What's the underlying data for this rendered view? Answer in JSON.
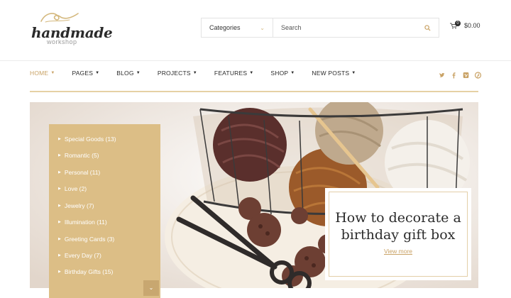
{
  "logo": {
    "brand": "handmade",
    "subtitle": "workshop"
  },
  "search": {
    "category_label": "Categories",
    "placeholder": "Search"
  },
  "cart": {
    "count": "0",
    "total": "$0.00"
  },
  "nav": {
    "items": [
      {
        "label": "HOME",
        "active": true
      },
      {
        "label": "PAGES"
      },
      {
        "label": "BLOG"
      },
      {
        "label": "PROJECTS"
      },
      {
        "label": "FEATURES"
      },
      {
        "label": "SHOP"
      },
      {
        "label": "NEW POSTS"
      }
    ],
    "social": [
      "twitter-icon",
      "facebook-icon",
      "vimeo-icon",
      "pinterest-icon"
    ]
  },
  "categories": [
    {
      "label": "Special Goods (13)"
    },
    {
      "label": "Romantic (5)"
    },
    {
      "label": "Personal (11)"
    },
    {
      "label": "Love (2)"
    },
    {
      "label": "Jewelry (7)"
    },
    {
      "label": "Illumination (11)"
    },
    {
      "label": "Greeting Cards (3)"
    },
    {
      "label": "Every Day (7)"
    },
    {
      "label": "Birthday Gifts (15)"
    }
  ],
  "promo": {
    "title": "How to decorate a birthday gift box",
    "link": "View more"
  },
  "colors": {
    "accent": "#c9a265",
    "panel": "#dcbe86"
  }
}
